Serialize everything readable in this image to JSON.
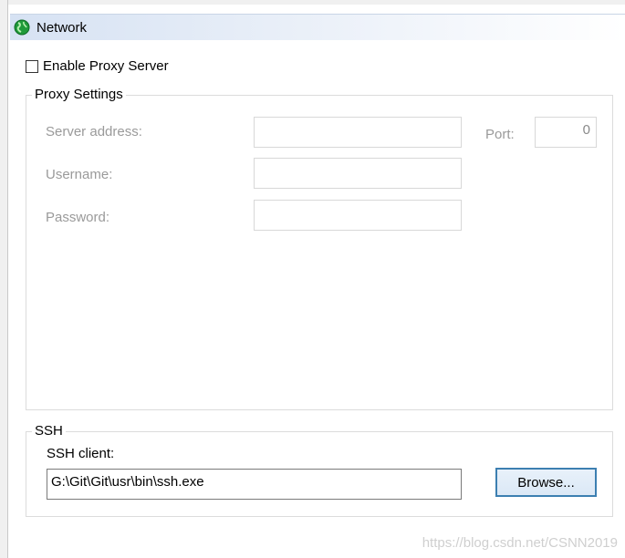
{
  "header": {
    "title": "Network",
    "icon": "network-globe-icon"
  },
  "proxy": {
    "enable_label": "Enable Proxy Server",
    "enabled": false,
    "group_title": "Proxy Settings",
    "server_address_label": "Server address:",
    "server_address_value": "",
    "port_label": "Port:",
    "port_value": "0",
    "username_label": "Username:",
    "username_value": "",
    "password_label": "Password:",
    "password_value": ""
  },
  "ssh": {
    "group_title": "SSH",
    "client_label": "SSH client:",
    "client_value": "G:\\Git\\Git\\usr\\bin\\ssh.exe",
    "browse_label": "Browse..."
  },
  "watermark": "https://blog.csdn.net/CSNN2019",
  "colors": {
    "header_gradient_start": "#d6e2f3",
    "disabled_text": "#9a9a9a",
    "button_border": "#3c7fb1"
  }
}
